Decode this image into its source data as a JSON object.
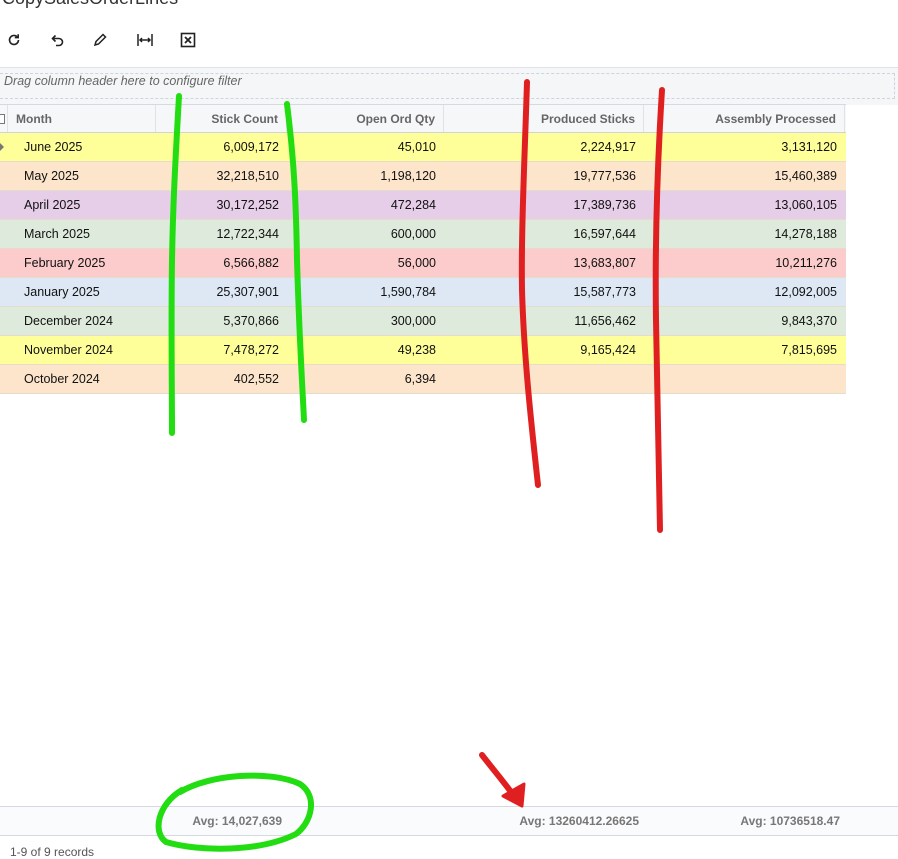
{
  "app": {
    "title": "CopySalesOrderLines"
  },
  "toolbar": {
    "buttons": [
      {
        "name": "refresh-button",
        "icon": "refresh-icon"
      },
      {
        "name": "undo-button",
        "icon": "undo-icon"
      },
      {
        "name": "edit-button",
        "icon": "pencil-icon"
      },
      {
        "name": "fit-columns-button",
        "icon": "fit-width-icon"
      },
      {
        "name": "export-excel-button",
        "icon": "excel-icon"
      }
    ]
  },
  "filter": {
    "hint": "Drag column header here to configure filter"
  },
  "table": {
    "columns": [
      "Month",
      "Stick Count",
      "Open Ord Qty",
      "Produced Sticks",
      "Assembly Processed"
    ],
    "rows": [
      {
        "month": "June 2025",
        "stick_count": "6,009,172",
        "open_ord_qty": "45,010",
        "produced_sticks": "2,224,917",
        "assembly_processed": "3,131,120",
        "color": "#ffff99"
      },
      {
        "month": "May 2025",
        "stick_count": "32,218,510",
        "open_ord_qty": "1,198,120",
        "produced_sticks": "19,777,536",
        "assembly_processed": "15,460,389",
        "color": "#fde5cc"
      },
      {
        "month": "April 2025",
        "stick_count": "30,172,252",
        "open_ord_qty": "472,284",
        "produced_sticks": "17,389,736",
        "assembly_processed": "13,060,105",
        "color": "#e6cde8"
      },
      {
        "month": "March 2025",
        "stick_count": "12,722,344",
        "open_ord_qty": "600,000",
        "produced_sticks": "16,597,644",
        "assembly_processed": "14,278,188",
        "color": "#deeadb"
      },
      {
        "month": "February 2025",
        "stick_count": "6,566,882",
        "open_ord_qty": "56,000",
        "produced_sticks": "13,683,807",
        "assembly_processed": "10,211,276",
        "color": "#fccbcb"
      },
      {
        "month": "January 2025",
        "stick_count": "25,307,901",
        "open_ord_qty": "1,590,784",
        "produced_sticks": "15,587,773",
        "assembly_processed": "12,092,005",
        "color": "#dde8f4"
      },
      {
        "month": "December 2024",
        "stick_count": "5,370,866",
        "open_ord_qty": "300,000",
        "produced_sticks": "11,656,462",
        "assembly_processed": "9,843,370",
        "color": "#deeadb"
      },
      {
        "month": "November 2024",
        "stick_count": "7,478,272",
        "open_ord_qty": "49,238",
        "produced_sticks": "9,165,424",
        "assembly_processed": "7,815,695",
        "color": "#ffff99"
      },
      {
        "month": "October 2024",
        "stick_count": "402,552",
        "open_ord_qty": "6,394",
        "produced_sticks": "",
        "assembly_processed": "",
        "color": "#fde5cc"
      }
    ]
  },
  "footer": {
    "stick_count_avg": "Avg: 14,027,639",
    "produced_sticks_avg": "Avg: 13260412.26625",
    "assembly_processed_avg": "Avg: 10736518.47"
  },
  "pager": {
    "text": "1-9 of 9 records"
  },
  "annotations": {
    "green": "#22dd11",
    "red": "#e02020"
  }
}
